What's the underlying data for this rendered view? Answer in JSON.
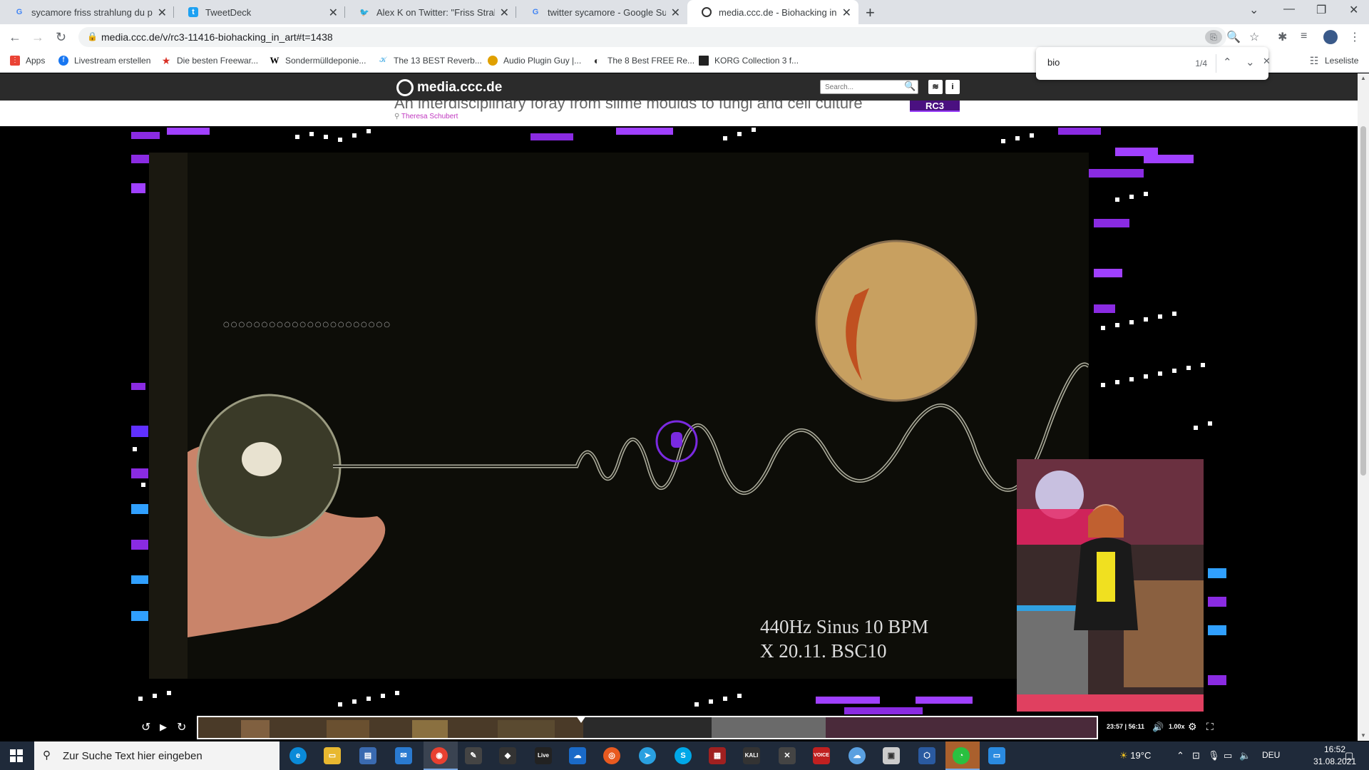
{
  "browser": {
    "tabs": [
      {
        "title": "sycamore friss strahlung du pilzt",
        "favicon": "google-icon",
        "favicon_color": "#4285f4",
        "active": false
      },
      {
        "title": "TweetDeck",
        "favicon": "tweetdeck-icon",
        "favicon_color": "#1da1f2",
        "active": false
      },
      {
        "title": "Alex K on Twitter: \"Friss Strahlung",
        "favicon": "twitter-icon",
        "favicon_color": "#1da1f2",
        "active": false
      },
      {
        "title": "twitter sycamore - Google Suche",
        "favicon": "google-icon",
        "favicon_color": "#4285f4",
        "active": false
      },
      {
        "title": "media.ccc.de - Biohacking in art",
        "favicon": "ccc-icon",
        "favicon_color": "#333333",
        "active": true
      }
    ],
    "url": "media.ccc.de/v/rc3-11416-biohacking_in_art#t=1438",
    "bookmarks": [
      {
        "label": "Apps",
        "icon": "apps-grid-icon",
        "color": "#ea4335"
      },
      {
        "label": "Livestream erstellen",
        "icon": "facebook-icon",
        "color": "#1877f2"
      },
      {
        "label": "Die besten Freewar...",
        "icon": "star-icon",
        "color": "#d93025"
      },
      {
        "label": "Sondermülldeponie...",
        "icon": "wikipedia-icon",
        "color": "#000000"
      },
      {
        "label": "The 13 BEST Reverb...",
        "icon": "plugin-icon",
        "color": "#2aa0e0"
      },
      {
        "label": "Audio Plugin Guy |...",
        "icon": "plugin-guy-icon",
        "color": "#e0a000"
      },
      {
        "label": "The 8 Best FREE Re...",
        "icon": "moon-icon",
        "color": "#333333"
      },
      {
        "label": "KORG Collection 3 f...",
        "icon": "korg-icon",
        "color": "#222222"
      }
    ],
    "reading_list": "Leseliste",
    "find": {
      "query": "bio",
      "count": "1/4"
    }
  },
  "site": {
    "logo": "media.ccc.de",
    "search_placeholder": "Search...",
    "talk_title": "An interdisciplinary foray from slime moulds to fungi and cell culture",
    "speaker": "Theresa Schubert",
    "badge": "RC3"
  },
  "video": {
    "caption_line1": "440Hz Sinus 10 BPM",
    "caption_line2": "X 20.11. BSC10",
    "time": "23:57 | 56:11",
    "speed": "1.00x",
    "progress": 0.426
  },
  "taskbar": {
    "search_placeholder": "Zur Suche Text hier eingeben",
    "weather": "19°C",
    "language": "DEU",
    "time": "16:52",
    "date": "31.08.2021"
  }
}
